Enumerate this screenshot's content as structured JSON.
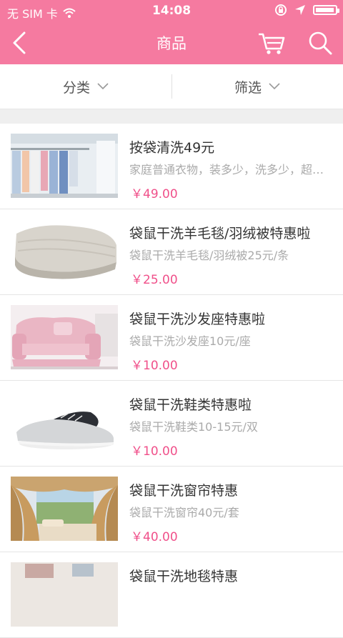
{
  "status": {
    "carrier": "无 SIM 卡",
    "time": "14:08",
    "battery_level": 0.95
  },
  "nav": {
    "title": "商品",
    "icons": [
      "back-chevron-icon",
      "cart-icon",
      "search-icon"
    ]
  },
  "filters": {
    "category_label": "分类",
    "filter_label": "筛选"
  },
  "colors": {
    "brand": "#f57aa0",
    "price": "#f0508a"
  },
  "products": [
    {
      "title": "按袋清洗49元",
      "desc": "家庭普通衣物，装多少，洗多少，超值优惠",
      "price": "￥49.00"
    },
    {
      "title": "袋鼠干洗羊毛毯/羽绒被特惠啦",
      "desc": "袋鼠干洗羊毛毯/羽绒被25元/条",
      "price": "￥25.00"
    },
    {
      "title": "袋鼠干洗沙发座特惠啦",
      "desc": "袋鼠干洗沙发座10元/座",
      "price": "￥10.00"
    },
    {
      "title": "袋鼠干洗鞋类特惠啦",
      "desc": "袋鼠干洗鞋类10-15元/双",
      "price": "￥10.00"
    },
    {
      "title": "袋鼠干洗窗帘特惠",
      "desc": "袋鼠干洗窗帘40元/套",
      "price": "￥40.00"
    },
    {
      "title": "袋鼠干洗地毯特惠",
      "desc": "",
      "price": ""
    }
  ]
}
